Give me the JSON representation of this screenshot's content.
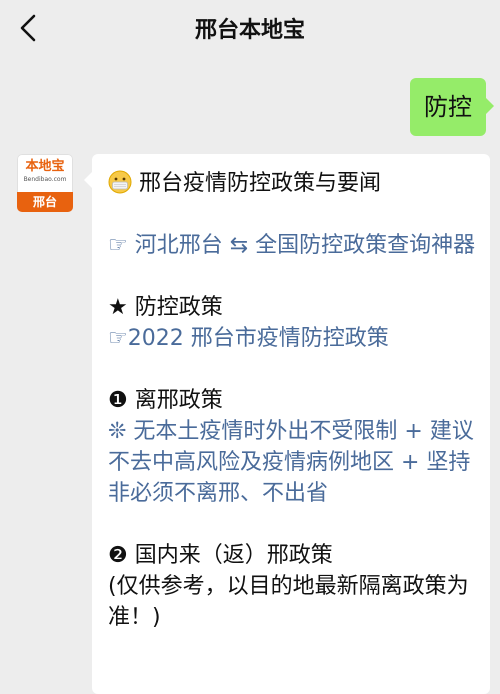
{
  "header": {
    "title": "邢台本地宝"
  },
  "sent_message": "防控",
  "avatar": {
    "brand": "本地宝",
    "sub": "Bendibao.com",
    "city": "邢台"
  },
  "reply": {
    "heading": "邢台疫情防控政策与要闻",
    "link1_prefix": "☞ ",
    "link1_place": "河北邢台",
    "link1_arrow": " ⇆ ",
    "link1_rest": "全国防控政策查询神器",
    "section1_title": "★ 防控政策",
    "link2_prefix": "☞",
    "link2": "2022 邢台市疫情防控政策",
    "section2_title": "❶ 离邢政策",
    "policy_line": "❊ 无本土疫情时外出不受限制 + 建议不去中高风险及疫情病例地区 + 坚持非必须不离邢、不出省",
    "section3_title": "❷ 国内来（返）邢政策",
    "note": "(仅供参考，以目的地最新隔离政策为准！)"
  },
  "icons": {
    "back": "chevron-left-icon",
    "heading_emoji": "mask-face-emoji-icon"
  }
}
